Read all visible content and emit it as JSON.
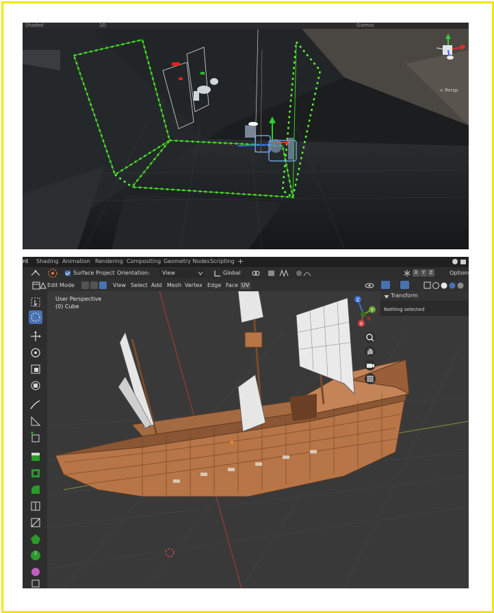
{
  "unity": {
    "toolbar_left": "Shaded",
    "toolbar_2d": "2D",
    "toolbar_gizmos": "Gizmos",
    "persp_label": "< Persp"
  },
  "blender": {
    "tabs": [
      {
        "label": "nt",
        "active": true
      },
      {
        "label": "Shading",
        "active": false
      },
      {
        "label": "Animation",
        "active": false
      },
      {
        "label": "Rendering",
        "active": false
      },
      {
        "label": "Compositing",
        "active": false
      },
      {
        "label": "Geometry Nodes",
        "active": false
      },
      {
        "label": "Scripting",
        "active": false
      }
    ],
    "tab_add": "+",
    "header": {
      "surface_project": "Surface Project",
      "orientation_label": "Orientation:",
      "orientation_value": "View",
      "transform_orientation": "Global",
      "axis_x": "X",
      "axis_y": "Y",
      "axis_z": "Z",
      "options": "Options"
    },
    "mode_row": {
      "mode": "Edit Mode",
      "menus": [
        "View",
        "Select",
        "Add",
        "Mesh",
        "Vertex",
        "Edge",
        "Face",
        "UV"
      ]
    },
    "viewport": {
      "title": "User Perspective",
      "object": "(0) Cube"
    },
    "n_panel": {
      "header": "Transform",
      "body": "Nothing selected"
    },
    "gizmo": {
      "x": "X",
      "y": "Y",
      "z": "Z"
    },
    "colors": {
      "accent": "#4772b3",
      "hull": "#b9774a",
      "sail": "#e6e6e6"
    }
  }
}
